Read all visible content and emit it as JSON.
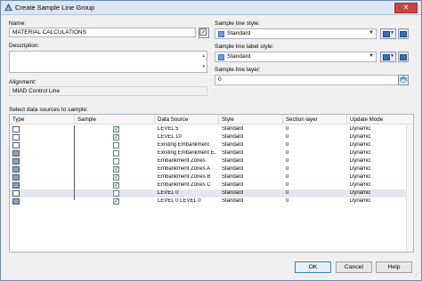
{
  "window": {
    "title": "Create Sample Line Group",
    "close_glyph": "✕"
  },
  "form": {
    "name_label": "Name:",
    "name_value": "MATERIAL CALCULATIONS",
    "description_label": "Description:",
    "description_value": "",
    "alignment_label": "Alignment:",
    "alignment_value": "MIAD Control Line",
    "sample_line_style_label": "Sample line style:",
    "sample_line_style_value": "Standard",
    "sample_line_label_style_label": "Sample line label style:",
    "sample_line_label_style_value": "Standard",
    "sample_line_layer_label": "Sample line layer:",
    "sample_line_layer_value": "0"
  },
  "grid": {
    "section_label": "Select data sources to sample:",
    "columns": [
      "Type",
      "Sample",
      "Data Source",
      "Style",
      "Section layer",
      "Update Mode"
    ],
    "rows": [
      {
        "type_icon": "surface-icon",
        "sample": true,
        "data_source": "LEVEL 5",
        "style": "Standard",
        "section_layer": "0",
        "update_mode": "Dynamic",
        "selected": false
      },
      {
        "type_icon": "surface-icon",
        "sample": true,
        "data_source": "LEVEL 10",
        "style": "Standard",
        "section_layer": "0",
        "update_mode": "Dynamic",
        "selected": false
      },
      {
        "type_icon": "surface-icon",
        "sample": false,
        "data_source": "Existing Embankment",
        "style": "Standard",
        "section_layer": "0",
        "update_mode": "Dynamic",
        "selected": false
      },
      {
        "type_icon": "corridor-surface-icon",
        "sample": false,
        "data_source": "Existing Embankment E...",
        "style": "Standard",
        "section_layer": "0",
        "update_mode": "Dynamic",
        "selected": false
      },
      {
        "type_icon": "corridor-surface-icon",
        "sample": false,
        "data_source": "Embankment Zones",
        "style": "Standard",
        "section_layer": "0",
        "update_mode": "Dynamic",
        "selected": false
      },
      {
        "type_icon": "corridor-surface-icon",
        "sample": true,
        "data_source": "Embankment Zones A",
        "style": "Standard",
        "section_layer": "0",
        "update_mode": "Dynamic",
        "selected": false
      },
      {
        "type_icon": "corridor-surface-icon",
        "sample": true,
        "data_source": "Embankment Zones B",
        "style": "Standard",
        "section_layer": "0",
        "update_mode": "Dynamic",
        "selected": false
      },
      {
        "type_icon": "corridor-surface-icon",
        "sample": true,
        "data_source": "Embankment Zones C",
        "style": "Standard",
        "section_layer": "0",
        "update_mode": "Dynamic",
        "selected": false
      },
      {
        "type_icon": "surface-icon",
        "sample": false,
        "data_source": "LEVEL 0",
        "style": "Standard",
        "section_layer": "0",
        "update_mode": "Dynamic",
        "selected": true
      },
      {
        "type_icon": "corridor-surface-icon",
        "sample": true,
        "data_source": "LEVEL 0 LEVEL 0",
        "style": "Standard",
        "section_layer": "0",
        "update_mode": "Dynamic",
        "selected": false
      }
    ]
  },
  "buttons": {
    "ok": "OK",
    "cancel": "Cancel",
    "help": "Help"
  },
  "colors": {
    "title_bar": "#dce6f3",
    "close_button": "#c9463d",
    "selected_row": "#e3e8ee",
    "check": "#2f7a1f"
  }
}
